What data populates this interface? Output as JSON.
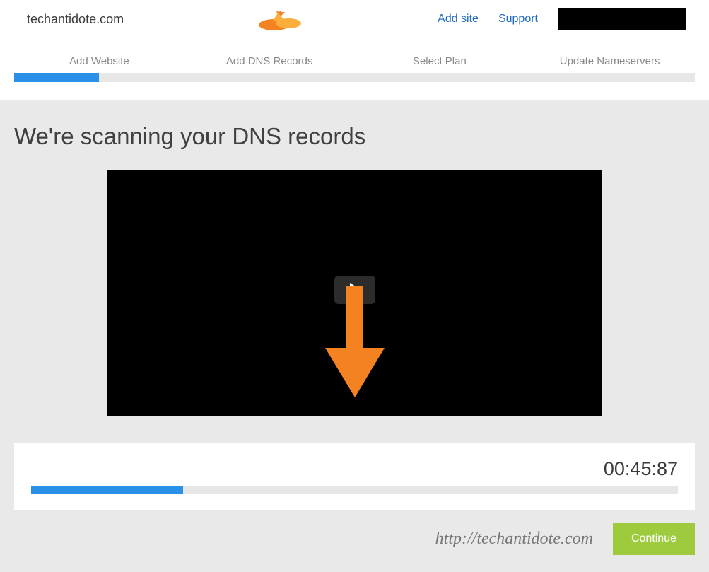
{
  "header": {
    "site_name": "techantidote.com",
    "links": {
      "add_site": "Add site",
      "support": "Support"
    }
  },
  "steps": {
    "items": [
      {
        "label": "Add Website"
      },
      {
        "label": "Add DNS Records"
      },
      {
        "label": "Select Plan"
      },
      {
        "label": "Update Nameservers"
      }
    ],
    "active_index": 0
  },
  "main": {
    "title": "We're scanning your DNS records"
  },
  "scan": {
    "timer": "00:45:87",
    "progress_pct": 23.5
  },
  "footer": {
    "watermark": "http://techantidote.com",
    "continue_label": "Continue"
  },
  "colors": {
    "accent_blue": "#2a8fe6",
    "link_blue": "#1e6cc0",
    "button_green": "#9dcb3d",
    "arrow_orange": "#f58220"
  }
}
